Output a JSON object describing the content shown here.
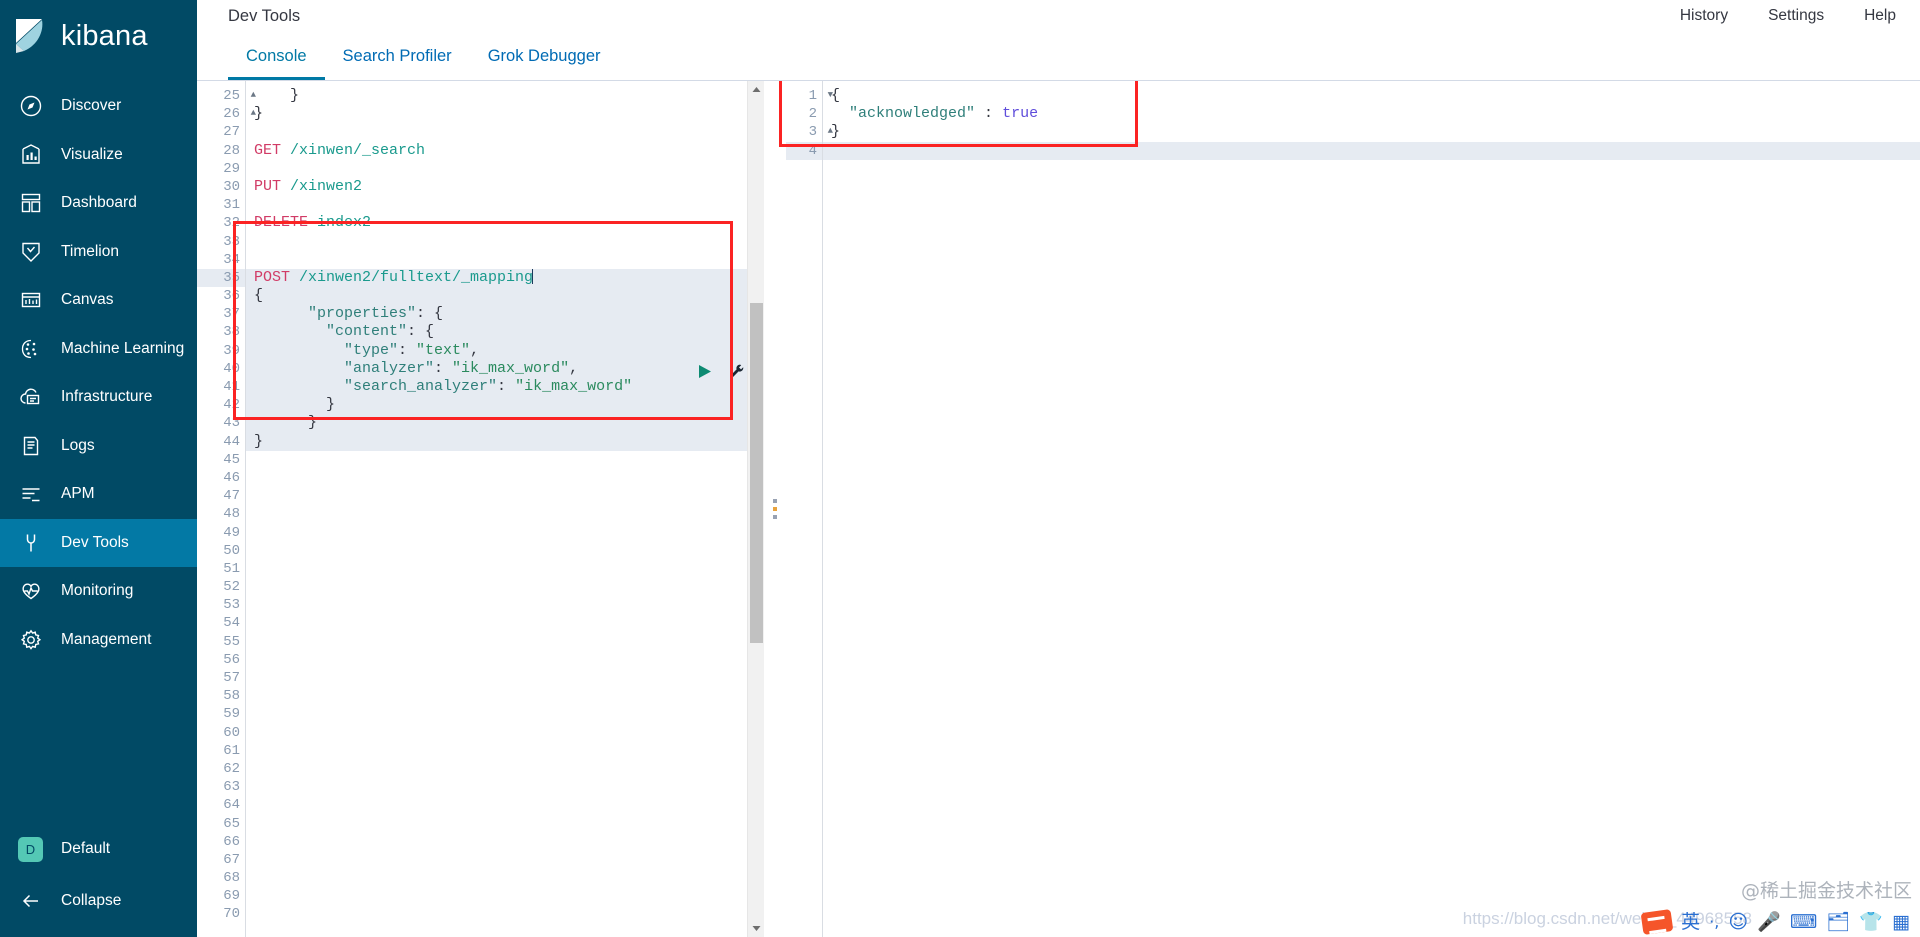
{
  "brand": {
    "name": "kibana",
    "logo_icon": "kibana-logo"
  },
  "sidebar": {
    "items": [
      {
        "label": "Discover",
        "icon": "discover-icon",
        "active": false
      },
      {
        "label": "Visualize",
        "icon": "visualize-icon",
        "active": false
      },
      {
        "label": "Dashboard",
        "icon": "dashboard-icon",
        "active": false
      },
      {
        "label": "Timelion",
        "icon": "timelion-icon",
        "active": false
      },
      {
        "label": "Canvas",
        "icon": "canvas-icon",
        "active": false
      },
      {
        "label": "Machine Learning",
        "icon": "machine-learning-icon",
        "active": false
      },
      {
        "label": "Infrastructure",
        "icon": "infrastructure-icon",
        "active": false
      },
      {
        "label": "Logs",
        "icon": "logs-icon",
        "active": false
      },
      {
        "label": "APM",
        "icon": "apm-icon",
        "active": false
      },
      {
        "label": "Dev Tools",
        "icon": "wrench-icon",
        "active": true
      },
      {
        "label": "Monitoring",
        "icon": "monitoring-icon",
        "active": false
      },
      {
        "label": "Management",
        "icon": "gear-icon",
        "active": false
      }
    ],
    "space": {
      "badge": "D",
      "label": "Default"
    },
    "collapse": {
      "label": "Collapse",
      "icon": "arrow-left-icon"
    },
    "bg_color": "#014a65",
    "active_color": "#0379a5"
  },
  "header": {
    "title": "Dev Tools",
    "links": [
      {
        "label": "History"
      },
      {
        "label": "Settings"
      },
      {
        "label": "Help"
      }
    ]
  },
  "tabs": [
    {
      "label": "Console",
      "active": true
    },
    {
      "label": "Search Profiler",
      "active": false
    },
    {
      "label": "Grok Debugger",
      "active": false
    }
  ],
  "editor": {
    "first_line": 25,
    "last_line": 70,
    "cursor_line": 35,
    "lines": [
      {
        "n": 25,
        "fold": "up",
        "tokens": [
          {
            "t": "    }",
            "c": "p"
          }
        ]
      },
      {
        "n": 26,
        "fold": "up",
        "tokens": [
          {
            "t": "}",
            "c": "p"
          }
        ]
      },
      {
        "n": 27,
        "fold": "",
        "tokens": []
      },
      {
        "n": 28,
        "fold": "",
        "tokens": [
          {
            "t": "GET ",
            "c": "m"
          },
          {
            "t": "/xinwen/_search",
            "c": "u"
          }
        ]
      },
      {
        "n": 29,
        "fold": "",
        "tokens": []
      },
      {
        "n": 30,
        "fold": "",
        "tokens": [
          {
            "t": "PUT ",
            "c": "m"
          },
          {
            "t": "/xinwen2",
            "c": "u"
          }
        ]
      },
      {
        "n": 31,
        "fold": "",
        "tokens": []
      },
      {
        "n": 32,
        "fold": "",
        "tokens": [
          {
            "t": "DELETE ",
            "c": "m"
          },
          {
            "t": "index2",
            "c": "u"
          }
        ]
      },
      {
        "n": 33,
        "fold": "",
        "tokens": []
      },
      {
        "n": 34,
        "fold": "",
        "tokens": []
      },
      {
        "n": 35,
        "fold": "",
        "hl": true,
        "cursor": true,
        "tokens": [
          {
            "t": "POST ",
            "c": "m"
          },
          {
            "t": "/xinwen2/fulltext/_mapping",
            "c": "u"
          }
        ]
      },
      {
        "n": 36,
        "fold": "down",
        "body": true,
        "tokens": [
          {
            "t": "{",
            "c": "p"
          }
        ]
      },
      {
        "n": 37,
        "fold": "down",
        "body": true,
        "tokens": [
          {
            "t": "      ",
            "c": "p"
          },
          {
            "t": "\"properties\"",
            "c": "k"
          },
          {
            "t": ": {",
            "c": "p"
          }
        ]
      },
      {
        "n": 38,
        "fold": "down",
        "body": true,
        "tokens": [
          {
            "t": "        ",
            "c": "p"
          },
          {
            "t": "\"content\"",
            "c": "k"
          },
          {
            "t": ": {",
            "c": "p"
          }
        ]
      },
      {
        "n": 39,
        "fold": "",
        "body": true,
        "tokens": [
          {
            "t": "          ",
            "c": "p"
          },
          {
            "t": "\"type\"",
            "c": "k"
          },
          {
            "t": ": ",
            "c": "p"
          },
          {
            "t": "\"text\"",
            "c": "s"
          },
          {
            "t": ",",
            "c": "p"
          }
        ]
      },
      {
        "n": 40,
        "fold": "",
        "body": true,
        "tokens": [
          {
            "t": "          ",
            "c": "p"
          },
          {
            "t": "\"analyzer\"",
            "c": "k"
          },
          {
            "t": ": ",
            "c": "p"
          },
          {
            "t": "\"ik_max_word\"",
            "c": "s"
          },
          {
            "t": ",",
            "c": "p"
          }
        ]
      },
      {
        "n": 41,
        "fold": "",
        "body": true,
        "tokens": [
          {
            "t": "          ",
            "c": "p"
          },
          {
            "t": "\"search_analyzer\"",
            "c": "k"
          },
          {
            "t": ": ",
            "c": "p"
          },
          {
            "t": "\"ik_max_word\"",
            "c": "s"
          }
        ]
      },
      {
        "n": 42,
        "fold": "up",
        "body": true,
        "tokens": [
          {
            "t": "        }",
            "c": "p"
          }
        ]
      },
      {
        "n": 43,
        "fold": "up",
        "body": true,
        "tokens": [
          {
            "t": "      }",
            "c": "p"
          }
        ]
      },
      {
        "n": 44,
        "fold": "up",
        "body": true,
        "tokens": [
          {
            "t": "}",
            "c": "p"
          }
        ]
      },
      {
        "n": 45,
        "fold": "",
        "tokens": []
      },
      {
        "n": 46,
        "fold": "",
        "tokens": []
      },
      {
        "n": 47,
        "fold": "",
        "tokens": []
      },
      {
        "n": 48,
        "fold": "",
        "tokens": []
      },
      {
        "n": 49,
        "fold": "",
        "tokens": []
      },
      {
        "n": 50,
        "fold": "",
        "tokens": []
      },
      {
        "n": 51,
        "fold": "",
        "tokens": []
      },
      {
        "n": 52,
        "fold": "",
        "tokens": []
      },
      {
        "n": 53,
        "fold": "",
        "tokens": []
      },
      {
        "n": 54,
        "fold": "",
        "tokens": []
      },
      {
        "n": 55,
        "fold": "",
        "tokens": []
      },
      {
        "n": 56,
        "fold": "",
        "tokens": []
      },
      {
        "n": 57,
        "fold": "",
        "tokens": []
      },
      {
        "n": 58,
        "fold": "",
        "tokens": []
      },
      {
        "n": 59,
        "fold": "",
        "tokens": []
      },
      {
        "n": 60,
        "fold": "",
        "tokens": []
      },
      {
        "n": 61,
        "fold": "",
        "tokens": []
      },
      {
        "n": 62,
        "fold": "",
        "tokens": []
      },
      {
        "n": 63,
        "fold": "",
        "tokens": []
      },
      {
        "n": 64,
        "fold": "",
        "tokens": []
      },
      {
        "n": 65,
        "fold": "",
        "tokens": []
      },
      {
        "n": 66,
        "fold": "",
        "tokens": []
      },
      {
        "n": 67,
        "fold": "",
        "tokens": []
      },
      {
        "n": 68,
        "fold": "",
        "tokens": []
      },
      {
        "n": 69,
        "fold": "",
        "tokens": []
      },
      {
        "n": 70,
        "fold": "",
        "tokens": []
      }
    ],
    "actions": {
      "play_icon": "play-request-icon",
      "wrench_icon": "wrench-menu-icon"
    }
  },
  "response": {
    "lines": [
      {
        "n": 1,
        "fold": "down",
        "tokens": [
          {
            "t": "{",
            "c": "p"
          }
        ]
      },
      {
        "n": 2,
        "fold": "",
        "tokens": [
          {
            "t": "  ",
            "c": "p"
          },
          {
            "t": "\"acknowledged\"",
            "c": "k"
          },
          {
            "t": " : ",
            "c": "p"
          },
          {
            "t": "true",
            "c": "b"
          }
        ]
      },
      {
        "n": 3,
        "fold": "up",
        "tokens": [
          {
            "t": "}",
            "c": "p"
          }
        ]
      },
      {
        "n": 4,
        "fold": "",
        "hl": true,
        "tokens": []
      }
    ]
  },
  "annotations": [
    {
      "name": "request-highlight-box"
    },
    {
      "name": "response-highlight-box"
    }
  ],
  "watermark": {
    "text": "@稀土掘金技术社区",
    "url_text": "https://blog.csdn.net/weixin_44968558"
  },
  "ime": {
    "items": [
      "英",
      "·,",
      "☺",
      "🎤",
      "⌨",
      "🗂",
      "👕",
      "▦"
    ]
  },
  "colors": {
    "accent": "#0079a5",
    "sidebar": "#014a65",
    "annot": "#fb2323",
    "method": "#d13b66",
    "url": "#1a9a8d"
  }
}
